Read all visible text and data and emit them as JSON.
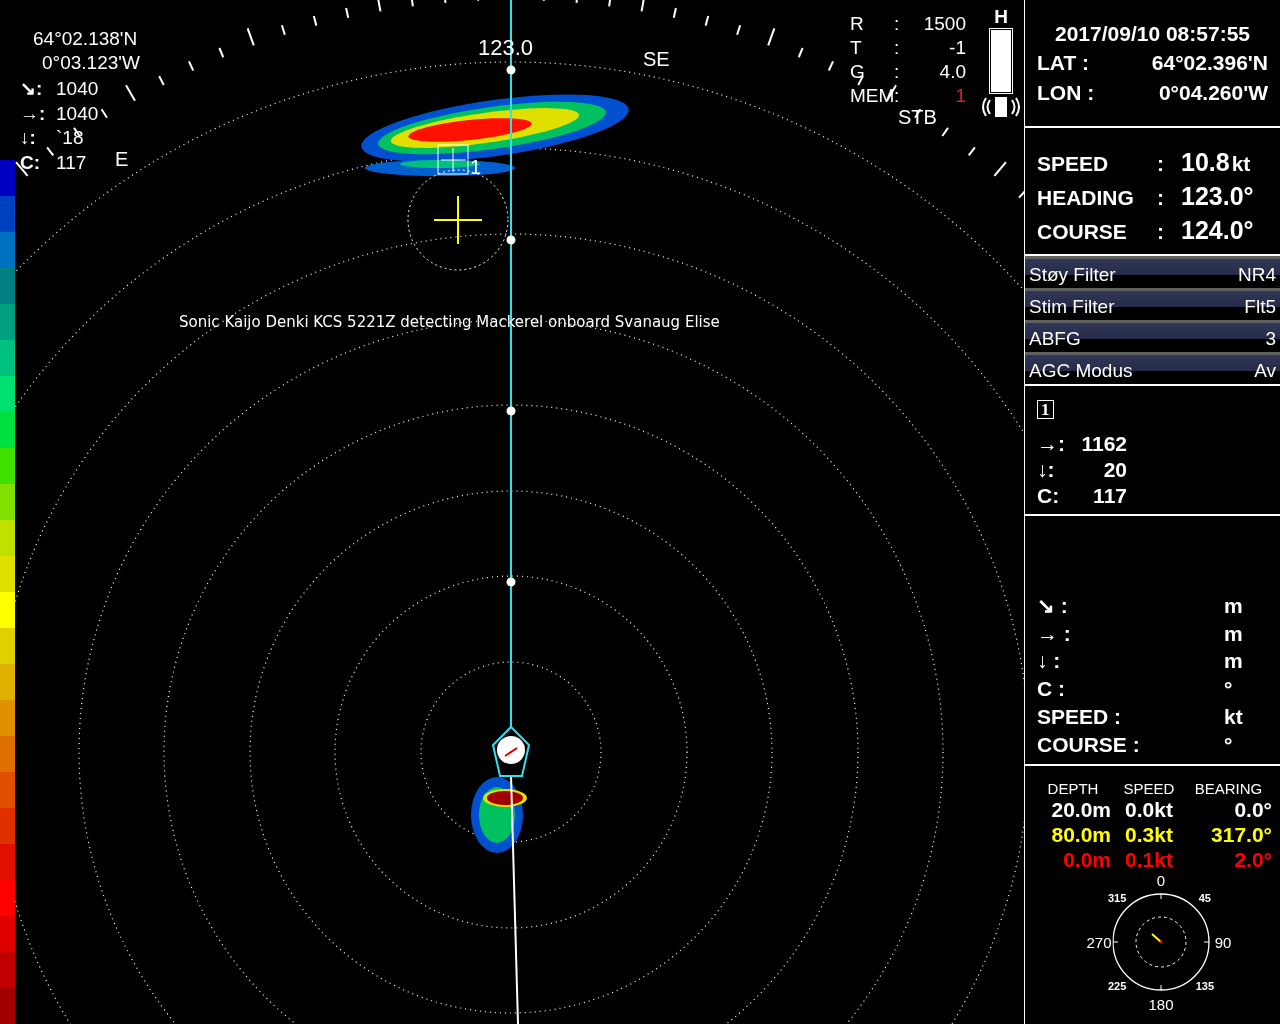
{
  "sonar": {
    "position": [
      "64°02.138'N",
      "0°03.123'W"
    ],
    "target_readings": [
      {
        "label": "↘:",
        "value": "1040"
      },
      {
        "label": "→:",
        "value": "1040"
      },
      {
        "label": "↓:",
        "value": "`18"
      },
      {
        "label": "C:",
        "value": "117"
      }
    ],
    "settings": [
      {
        "label": "R",
        "sep": ":",
        "value": "1500",
        "alert": false
      },
      {
        "label": "T",
        "sep": ":",
        "value": "-1",
        "alert": false
      },
      {
        "label": "G",
        "sep": ":",
        "value": "4.0",
        "alert": false
      },
      {
        "label": "MEM",
        "sep": ":",
        "value": "1",
        "alert": true
      }
    ],
    "gain_label": "H",
    "heading_label": "123.0",
    "bearing_labels": [
      {
        "text": "SE",
        "kind": "se"
      },
      {
        "text": "E",
        "kind": "e"
      },
      {
        "text": "STB",
        "kind": "stb"
      }
    ],
    "marker_label": "1",
    "caption": "Sonic Kaijo Denki KCS 5221Z detecting Mackerel onboard Svanaug Elise"
  },
  "panel": {
    "datetime": "2017/09/10 08:57:55",
    "position": [
      {
        "label": "LAT :",
        "value": "64°02.396'N"
      },
      {
        "label": "LON :",
        "value": "0°04.260'W"
      }
    ],
    "navigation": [
      {
        "label": "SPEED",
        "sep": ":",
        "value": "10.8",
        "unit": "kt"
      },
      {
        "label": "HEADING",
        "sep": ":",
        "value": "123.0°"
      },
      {
        "label": "COURSE",
        "sep": ":",
        "value": "124.0°"
      }
    ],
    "filters": [
      {
        "label": "Støy Filter",
        "value": "NR4"
      },
      {
        "label": "Stim Filter",
        "value": "Flt5"
      },
      {
        "label": "ABFG",
        "value": "3"
      },
      {
        "label": "AGC Modus",
        "value": "Av"
      }
    ],
    "marker": {
      "number": "1",
      "readings": [
        {
          "label": "→:",
          "value": "1162"
        },
        {
          "label": "↓:",
          "value": "20"
        },
        {
          "label": "C:",
          "value": "117"
        }
      ]
    },
    "cursor_readings": [
      {
        "label": "↘ :",
        "unit": "m"
      },
      {
        "label": "→ :",
        "unit": "m"
      },
      {
        "label": "↓ :",
        "unit": "m"
      },
      {
        "label": "C :",
        "unit": "°"
      },
      {
        "label": "SPEED     :",
        "unit": "kt"
      },
      {
        "label": "COURSE :",
        "unit": "°"
      }
    ],
    "current": {
      "columns": [
        "DEPTH",
        "SPEED",
        "BEARING"
      ],
      "rows": [
        {
          "depth": "20.0m",
          "speed": "0.0kt",
          "bearing": "0.0°",
          "color": "#ffffff"
        },
        {
          "depth": "80.0m",
          "speed": "0.3kt",
          "bearing": "317.0°",
          "color": "#ffff00"
        },
        {
          "depth": "0.0m",
          "speed": "0.1kt",
          "bearing": "2.0°",
          "color": "#ff0000"
        }
      ],
      "compass_labels": [
        {
          "text": "0",
          "kind": "major"
        },
        {
          "text": "45",
          "kind": "minor"
        },
        {
          "text": "90",
          "kind": "major"
        },
        {
          "text": "135",
          "kind": "minor"
        },
        {
          "text": "180",
          "kind": "major"
        },
        {
          "text": "225",
          "kind": "minor"
        },
        {
          "text": "270",
          "kind": "major"
        },
        {
          "text": "315",
          "kind": "minor"
        }
      ]
    }
  }
}
